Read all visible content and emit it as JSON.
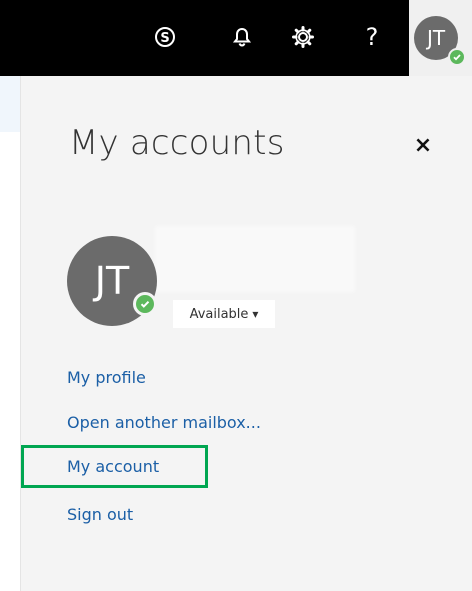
{
  "topbar": {
    "icons": [
      {
        "name": "skype-icon",
        "glyph": "S"
      },
      {
        "name": "bell-icon",
        "glyph": "bell"
      },
      {
        "name": "gear-icon",
        "glyph": "gear"
      },
      {
        "name": "help-icon",
        "glyph": "?"
      }
    ],
    "user_initials": "JT",
    "colors": {
      "background": "#000000",
      "user_tile": "#f0f0f0"
    }
  },
  "panel": {
    "title": "My accounts",
    "close_label": "×",
    "avatar_initials": "JT",
    "status": "Available",
    "status_caret": "▾",
    "links": [
      "My profile",
      "Open another mailbox...",
      "My account",
      "Sign out"
    ],
    "highlighted_link": "My account",
    "colors": {
      "link": "#1b5fa6",
      "presence": "#5cb85c",
      "highlight_border": "#00a651"
    }
  }
}
